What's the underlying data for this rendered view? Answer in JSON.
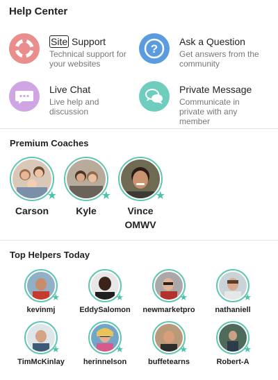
{
  "header": {
    "title": "Help Center"
  },
  "options": [
    {
      "label_prefix": "Site",
      "label_rest": " Support",
      "desc": "Technical support for your websites",
      "icon": "lifebuoy-icon",
      "color": "#e98d8d"
    },
    {
      "label": "Ask a Question",
      "desc": "Get answers from the community",
      "icon": "question-icon",
      "color": "#5b9bdf"
    },
    {
      "label": "Live Chat",
      "desc": "Live help and discussion",
      "icon": "chat-bubble-icon",
      "color": "#cfa5e3"
    },
    {
      "label": "Private Message",
      "desc": "Communicate in private with any member",
      "icon": "message-bubbles-icon",
      "color": "#6fcdbd"
    }
  ],
  "coaches": {
    "title": "Premium Coaches",
    "items": [
      {
        "name": "Carson"
      },
      {
        "name": "Kyle"
      },
      {
        "name": "Vince OMWV"
      }
    ]
  },
  "helpers": {
    "title": "Top Helpers Today",
    "items": [
      {
        "name": "kevinmj"
      },
      {
        "name": "EddySalomon"
      },
      {
        "name": "newmarketpro"
      },
      {
        "name": "nathaniell"
      },
      {
        "name": "TimMcKinlay"
      },
      {
        "name": "herinnelson"
      },
      {
        "name": "buffetearns"
      },
      {
        "name": "Robert-A"
      }
    ]
  },
  "colors": {
    "accent": "#5fc6b2"
  }
}
